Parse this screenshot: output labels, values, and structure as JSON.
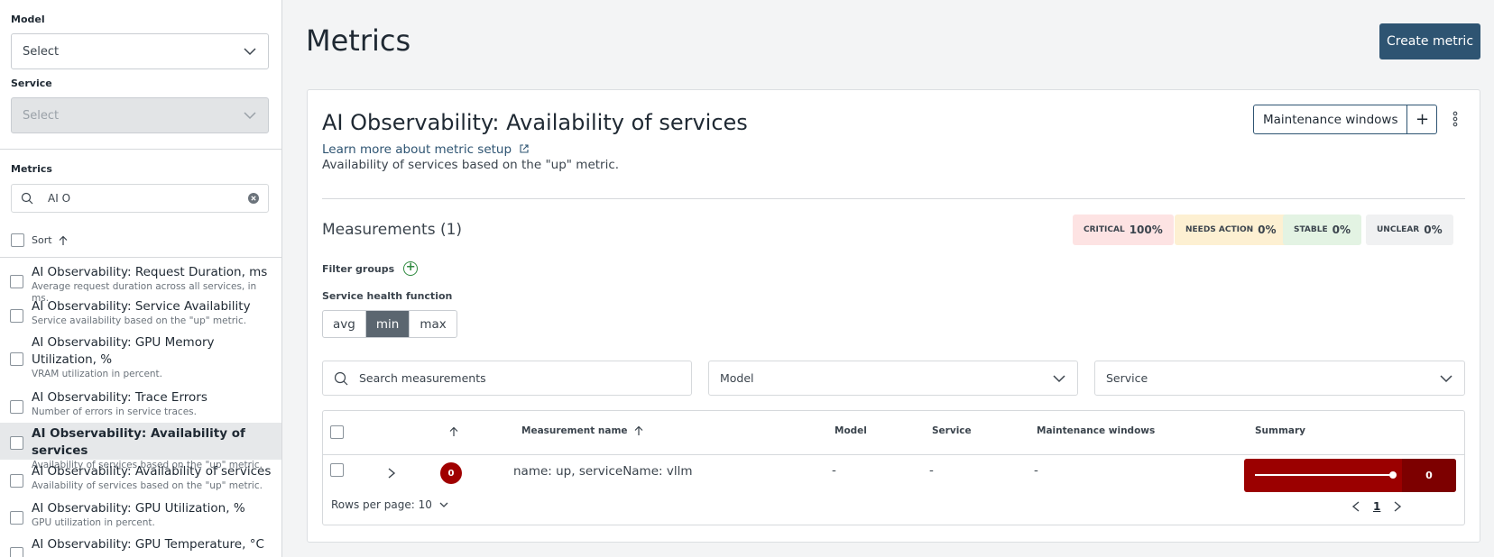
{
  "sidebar": {
    "model_label": "Model",
    "model_value": "Select",
    "service_label": "Service",
    "service_value": "Select",
    "metrics_label": "Metrics",
    "search_value": "AI O",
    "sort_label": "Sort",
    "items": [
      {
        "title": "AI Observability: Request Duration, ms",
        "desc": "Average request duration across all services, in ms."
      },
      {
        "title": "AI Observability: Service Availability",
        "desc": "Service availability based on the \"up\" metric."
      },
      {
        "title": "AI Observability: GPU Memory",
        "title2": "Utilization, %",
        "desc": "VRAM utilization in percent."
      },
      {
        "title": "AI Observability: Trace Errors",
        "desc": "Number of errors in service traces."
      },
      {
        "title": "AI Observability: Availability of services",
        "desc": "Availability of services based on the \"up\" metric."
      },
      {
        "title": "AI Observability: Availability of services",
        "desc": "Availability of services based on the \"up\" metric."
      },
      {
        "title": "AI Observability: GPU Utilization, %",
        "desc": "GPU utilization in percent."
      },
      {
        "title": "AI Observability: GPU Temperature, °C",
        "desc": ""
      }
    ]
  },
  "header": {
    "title": "Metrics",
    "create_label": "Create metric"
  },
  "card": {
    "title": "AI Observability: Availability of services",
    "learn_more": "Learn more about metric setup",
    "description": "Availability of services based on the \"up\" metric.",
    "maintenance_label": "Maintenance windows",
    "measurements_title": "Measurements (1)",
    "badges": [
      {
        "label": "CRITICAL",
        "value": "100%",
        "color": "#fde3e3"
      },
      {
        "label": "NEEDS ACTION",
        "value": "0%",
        "color": "#fdf0d2"
      },
      {
        "label": "STABLE",
        "value": "0%",
        "color": "#e3f3e3"
      },
      {
        "label": "UNCLEAR",
        "value": "0%",
        "color": "#f0f1f2"
      }
    ],
    "filter_groups_label": "Filter groups",
    "health_label": "Service health function",
    "health_options": [
      "avg",
      "min",
      "max"
    ],
    "health_selected": "min",
    "search_placeholder": "Search measurements",
    "model_filter": "Model",
    "service_filter": "Service"
  },
  "table": {
    "headers": [
      "Measurement name",
      "Model",
      "Service",
      "Maintenance windows",
      "Summary"
    ],
    "row": {
      "count": "0",
      "name": "name: up, serviceName: vllm",
      "model": "-",
      "service": "-",
      "maintenance": "-",
      "summary_value": "0"
    },
    "rows_per_page_label": "Rows per page: 10",
    "page": "1"
  }
}
